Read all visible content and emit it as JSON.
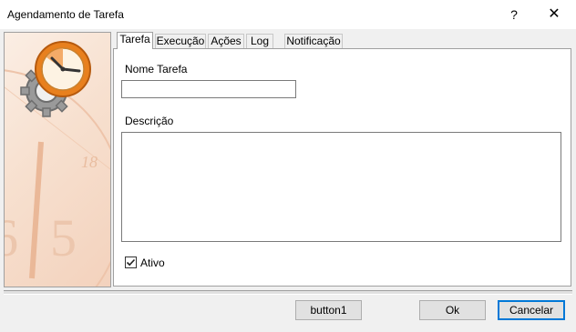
{
  "window": {
    "title": "Agendamento de Tarefa",
    "help_glyph": "?",
    "close_glyph": "✕"
  },
  "tabs": [
    {
      "label": "Tarefa",
      "active": true
    },
    {
      "label": "Execução",
      "active": false
    },
    {
      "label": "Ações",
      "active": false
    },
    {
      "label": "Log",
      "active": false
    },
    {
      "label": "Notificação",
      "active": false
    }
  ],
  "form": {
    "name_label": "Nome Tarefa",
    "name_value": "",
    "description_label": "Descrição",
    "description_value": "",
    "active_label": "Ativo",
    "active_checked": true
  },
  "side_panel": {
    "icon": "clock-gear-icon",
    "background_numerals": [
      "18",
      "5"
    ]
  },
  "buttons": {
    "button1": "button1",
    "ok": "Ok",
    "cancel": "Cancelar"
  },
  "colors": {
    "default_button_border": "#0078d7",
    "clock_orange": "#e8801e",
    "panel_peach": "#f7e0cf"
  }
}
